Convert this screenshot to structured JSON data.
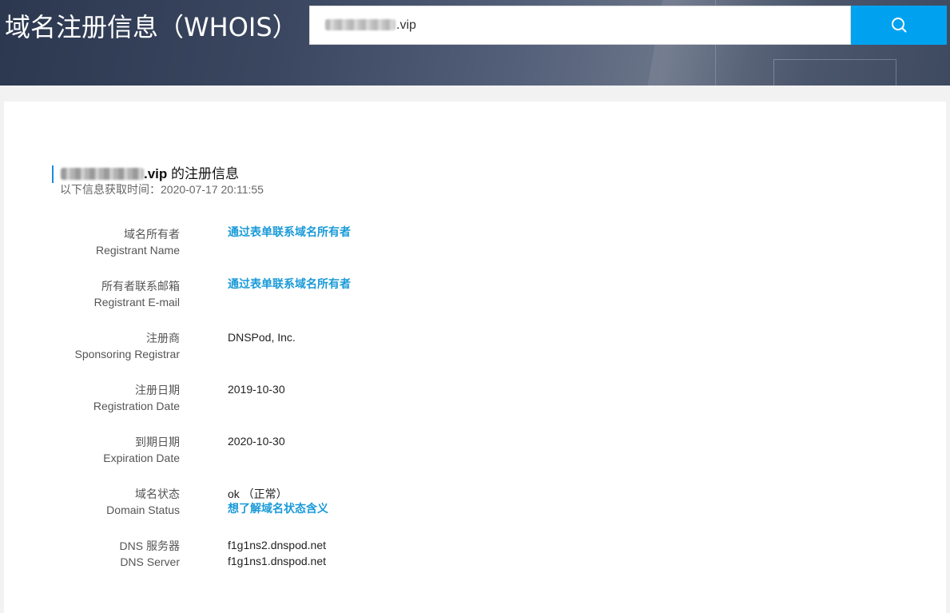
{
  "header": {
    "title": "域名注册信息（WHOIS）",
    "search_value": ".vip",
    "search_icon": "search-icon",
    "accent_color": "#00a2f0"
  },
  "domain": {
    "heading_suffix_strong": ".vip",
    "heading_suffix": " 的注册信息",
    "fetch_time": "以下信息获取时间：2020-07-17 20:11:55"
  },
  "fields": [
    {
      "label_cn": "域名所有者",
      "label_en": "Registrant Name",
      "value": "通过表单联系域名所有者"
    },
    {
      "label_cn": "所有者联系邮箱",
      "label_en": "Registrant E-mail",
      "value": "通过表单联系域名所有者"
    },
    {
      "label_cn": "注册商",
      "label_en": "Sponsoring Registrar",
      "value": "DNSPod, Inc."
    },
    {
      "label_cn": "注册日期",
      "label_en": "Registration Date",
      "value": "2019-10-30"
    },
    {
      "label_cn": "到期日期",
      "label_en": "Expiration Date",
      "value": "2020-10-30"
    },
    {
      "label_cn": "域名状态",
      "label_en": "Domain Status",
      "value": "ok （正常）",
      "value2": "想了解域名状态含义"
    },
    {
      "label_cn": "DNS 服务器",
      "label_en": "DNS Server",
      "value": "f1g1ns2.dnspod.net",
      "value2": "f1g1ns1.dnspod.net"
    }
  ]
}
